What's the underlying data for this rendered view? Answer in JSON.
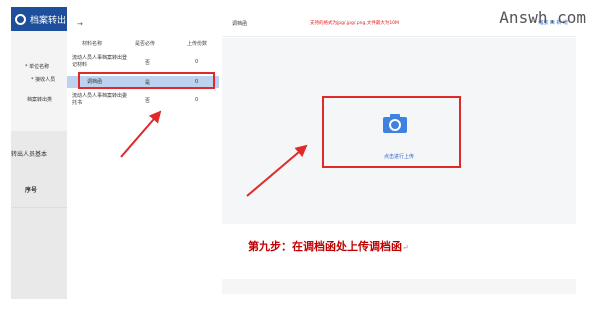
{
  "watermark": "Answh.com",
  "background_app": {
    "header_title": "档案转出",
    "form_labels": [
      "* 单位名称",
      "* 接收人员",
      "档案转出类"
    ],
    "section_title": "转出人员基本",
    "column_header": "序号"
  },
  "modal_left": {
    "back_arrow": "→",
    "table_headers": [
      "材料名称",
      "是否必传",
      "上传份数"
    ],
    "rows": [
      {
        "name": "流动人员人事档案转出登记材料",
        "required": "否",
        "count": "0"
      },
      {
        "name": "调档函",
        "required": "是",
        "count": "0"
      },
      {
        "name": "流动人员人事档案转出委托书",
        "required": "否",
        "count": "0"
      }
    ]
  },
  "right_panel": {
    "title": "调档函",
    "hint": "支持的格式为jpg/.jpg/.png,文件最大为10M",
    "tools": "一 缩放  口 新 增",
    "upload_text": "点击进行上传"
  },
  "instruction": {
    "text": "第九步：在调档函处上传调档函",
    "mark": "↵"
  },
  "colors": {
    "accent_red": "#e02a2a",
    "header_blue": "#1e4f9c",
    "link_blue": "#2b5fc6",
    "selected_row": "#bcd2ee"
  }
}
